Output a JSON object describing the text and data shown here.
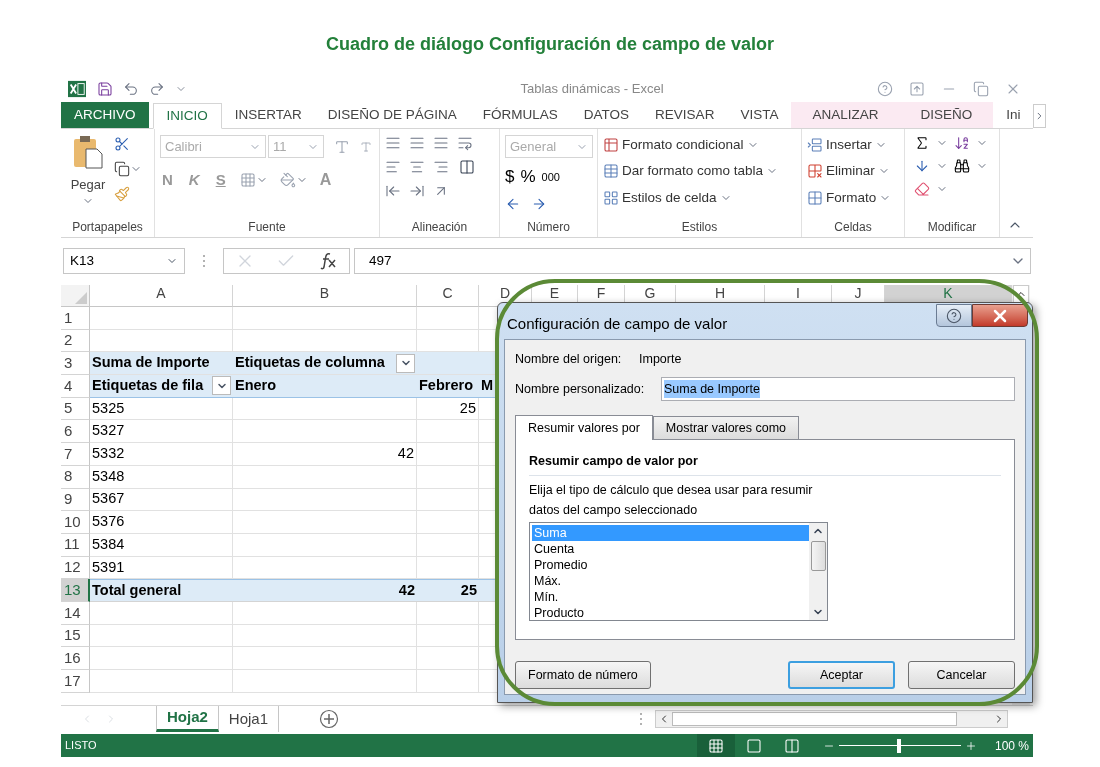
{
  "heading": "Cuadro de diálogo Configuración de campo de valor",
  "window": {
    "title": "Tablas dinámicas - Excel"
  },
  "ribbon_tabs": [
    {
      "label": "ARCHIVO",
      "kind": "file",
      "selected": false
    },
    {
      "label": "INICIO",
      "kind": "normal",
      "selected": true
    },
    {
      "label": "INSERTAR",
      "kind": "normal",
      "selected": false
    },
    {
      "label": "DISEÑO DE PÁGINA",
      "kind": "normal",
      "selected": false
    },
    {
      "label": "FÓRMULAS",
      "kind": "normal",
      "selected": false
    },
    {
      "label": "DATOS",
      "kind": "normal",
      "selected": false
    },
    {
      "label": "REVISAR",
      "kind": "normal",
      "selected": false
    },
    {
      "label": "VISTA",
      "kind": "normal",
      "selected": false
    },
    {
      "label": "ANALIZAR",
      "kind": "contextual",
      "selected": false
    },
    {
      "label": "DISEÑO",
      "kind": "contextual",
      "selected": false
    },
    {
      "label": "Ini",
      "kind": "normal",
      "selected": false
    }
  ],
  "clipboard": {
    "paste_label": "Pegar",
    "group": "Portapapeles"
  },
  "font": {
    "name": "Calibri",
    "size": "11",
    "disabled": true,
    "styles": [
      "N",
      "K",
      "S"
    ],
    "color_label": "A",
    "group": "Fuente"
  },
  "alignment": {
    "group": "Alineación"
  },
  "number": {
    "format": "General",
    "disabled": true,
    "symbols": [
      "$",
      "%",
      "000"
    ],
    "group": "Número"
  },
  "styles": {
    "items": [
      "Formato condicional",
      "Dar formato como tabla",
      "Estilos de celda"
    ],
    "group": "Estilos"
  },
  "cells": {
    "items": [
      "Insertar",
      "Eliminar",
      "Formato"
    ],
    "group": "Celdas"
  },
  "editing": {
    "group": "Modificar"
  },
  "formula_bar": {
    "name_box": "K13",
    "formula": "497"
  },
  "columns": [
    {
      "label": "A",
      "selected": false
    },
    {
      "label": "B",
      "selected": false
    },
    {
      "label": "C",
      "selected": false
    },
    {
      "label": "D",
      "selected": false
    },
    {
      "label": "E",
      "selected": false
    },
    {
      "label": "F",
      "selected": false
    },
    {
      "label": "G",
      "selected": false
    },
    {
      "label": "H",
      "selected": false
    },
    {
      "label": "I",
      "selected": false
    },
    {
      "label": "J",
      "selected": false
    },
    {
      "label": "K",
      "selected": true
    }
  ],
  "rows": [
    {
      "number": "1",
      "kind": "plain",
      "selected": false
    },
    {
      "number": "2",
      "kind": "plain",
      "selected": false
    },
    {
      "number": "3",
      "kind": "header",
      "selected": false,
      "a": "Suma de Importe",
      "b": "Etiquetas de columna",
      "a_filter": false,
      "b_filter": true
    },
    {
      "number": "4",
      "kind": "subheader",
      "selected": false,
      "a": "Etiquetas de fila",
      "b": "Enero",
      "c": "Febrero",
      "d": "M",
      "a_filter": true,
      "b_filter": false
    },
    {
      "number": "5",
      "kind": "plain",
      "selected": false,
      "a": "5325",
      "c": "25"
    },
    {
      "number": "6",
      "kind": "plain",
      "selected": false,
      "a": "5327"
    },
    {
      "number": "7",
      "kind": "plain",
      "selected": false,
      "a": "5332",
      "b": "42"
    },
    {
      "number": "8",
      "kind": "plain",
      "selected": false,
      "a": "5348"
    },
    {
      "number": "9",
      "kind": "plain",
      "selected": false,
      "a": "5367"
    },
    {
      "number": "10",
      "kind": "plain",
      "selected": false,
      "a": "5376"
    },
    {
      "number": "11",
      "kind": "plain",
      "selected": false,
      "a": "5384"
    },
    {
      "number": "12",
      "kind": "plain",
      "selected": false,
      "a": "5391"
    },
    {
      "number": "13",
      "kind": "total",
      "selected": true,
      "a": "Total general",
      "b": "42",
      "c": "25"
    },
    {
      "number": "14",
      "kind": "plain",
      "selected": false
    },
    {
      "number": "15",
      "kind": "plain",
      "selected": false
    },
    {
      "number": "16",
      "kind": "plain",
      "selected": false
    },
    {
      "number": "17",
      "kind": "plain",
      "selected": false
    }
  ],
  "sheet_tabs": [
    {
      "label": "Hoja2",
      "selected": true
    },
    {
      "label": "Hoja1",
      "selected": false
    }
  ],
  "status_bar": {
    "status": "LISTO",
    "views": [
      {
        "kind": "normal",
        "selected": true
      },
      {
        "kind": "page_layout",
        "selected": false
      },
      {
        "kind": "page_break",
        "selected": false
      }
    ],
    "zoom": {
      "level": 0.49,
      "reading": "100 %"
    }
  },
  "dialog": {
    "title": "Configuración de campo de valor",
    "source_label": "Nombre del origen:",
    "source_value": "Importe",
    "custom_label": "Nombre personalizado:",
    "custom_value": "Suma de Importe",
    "custom_value_highlighted": true,
    "tabs": [
      {
        "label": "Resumir valores por",
        "selected": true
      },
      {
        "label": "Mostrar valores como",
        "selected": false
      }
    ],
    "section_title": "Resumir campo de valor por",
    "description": "Elija el tipo de cálculo que desea usar para resumir datos del campo seleccionado",
    "functions": [
      {
        "label": "Suma",
        "selected": true
      },
      {
        "label": "Cuenta",
        "selected": false
      },
      {
        "label": "Promedio",
        "selected": false
      },
      {
        "label": "Máx.",
        "selected": false
      },
      {
        "label": "Mín.",
        "selected": false
      },
      {
        "label": "Producto",
        "selected": false
      }
    ],
    "buttons": [
      {
        "label": "Formato de número",
        "default": false
      },
      {
        "label": "Aceptar",
        "default": true
      },
      {
        "label": "Cancelar",
        "default": false
      }
    ]
  }
}
